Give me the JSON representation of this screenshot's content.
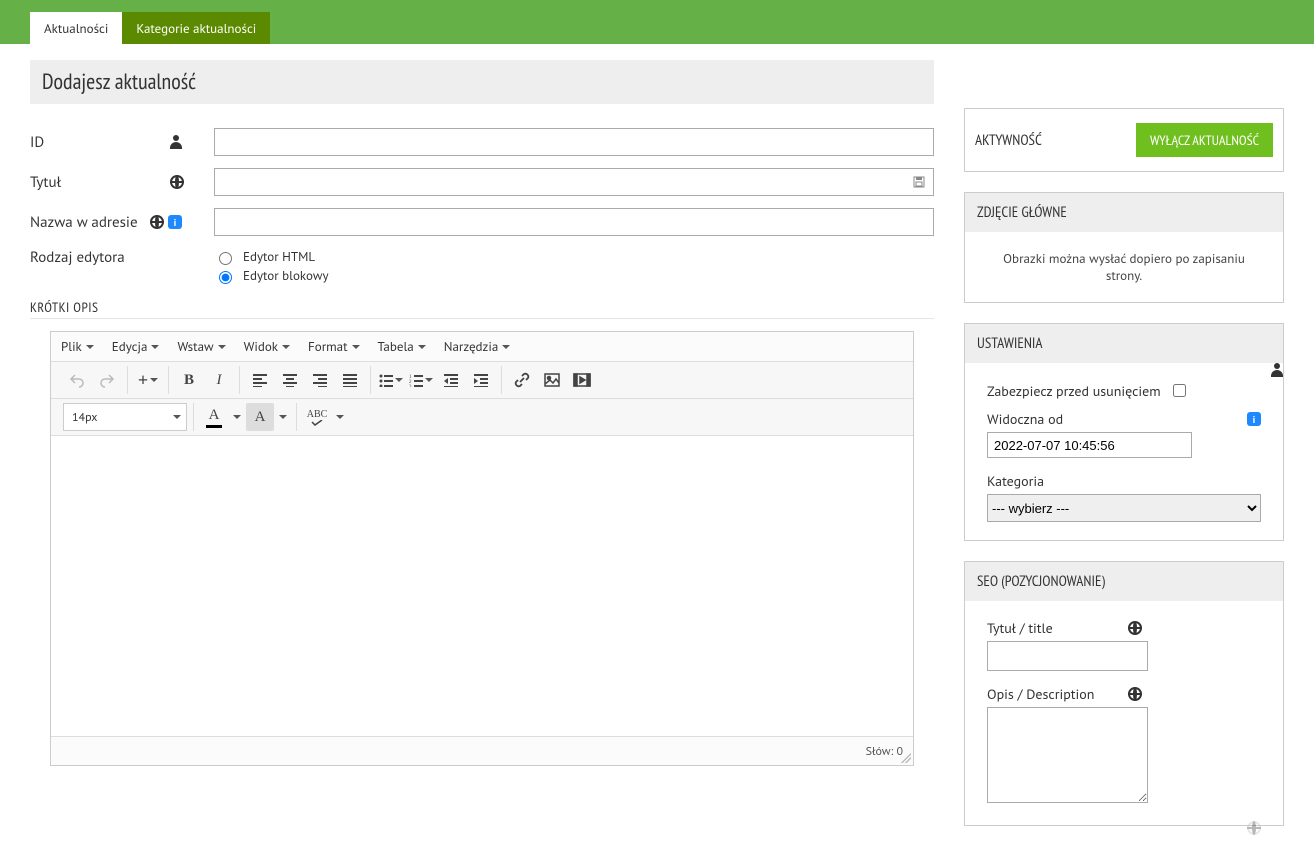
{
  "tabs": {
    "active": "Aktualności",
    "inactive": "Kategorie aktualności"
  },
  "page_title": "Dodajesz aktualność",
  "form": {
    "id_label": "ID",
    "title_label": "Tytuł",
    "slug_label": "Nazwa w adresie",
    "editor_type_label": "Rodzaj edytora",
    "editor_html": "Edytor HTML",
    "editor_block": "Edytor blokowy"
  },
  "short_desc_heading": "KRÓTKI OPIS",
  "editor_menu": {
    "file": "Plik",
    "edit": "Edycja",
    "insert": "Wstaw",
    "view": "Widok",
    "format": "Format",
    "table": "Tabela",
    "tools": "Narzędzia"
  },
  "editor_toolbar": {
    "font_size": "14px"
  },
  "editor_status": {
    "words_label": "Słów:",
    "words_count": "0"
  },
  "activity": {
    "label": "AKTYWNOŚĆ",
    "button": "WYŁĄCZ AKTUALNOŚĆ"
  },
  "main_image": {
    "heading": "ZDJĘCIE GŁÓWNE",
    "note": "Obrazki można wysłać dopiero po zapisaniu strony."
  },
  "settings": {
    "heading": "USTAWIENIA",
    "protect_label": "Zabezpiecz przed usunięciem",
    "visible_from_label": "Widoczna od",
    "visible_from_value": "2022-07-07 10:45:56",
    "category_label": "Kategoria",
    "category_placeholder": "--- wybierz ---"
  },
  "seo": {
    "heading": "SEO (POZYCJONOWANIE)",
    "title_label": "Tytuł / title",
    "desc_label": "Opis / Description"
  }
}
